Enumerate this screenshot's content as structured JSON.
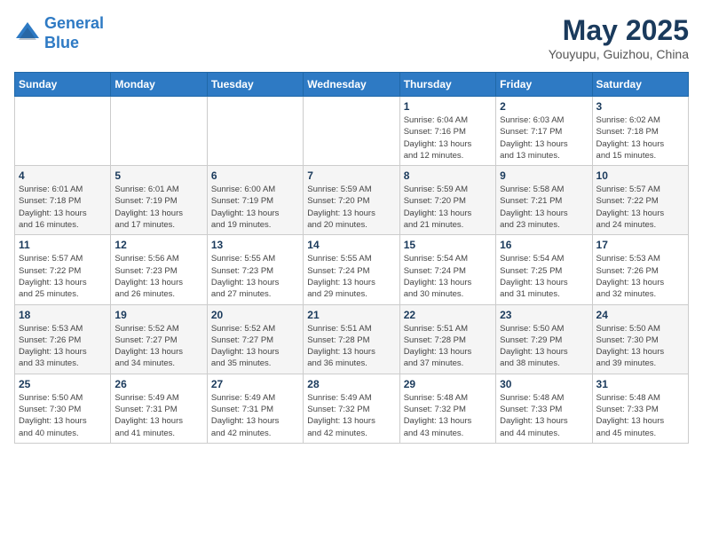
{
  "header": {
    "logo_line1": "General",
    "logo_line2": "Blue",
    "month_year": "May 2025",
    "location": "Youyupu, Guizhou, China"
  },
  "weekdays": [
    "Sunday",
    "Monday",
    "Tuesday",
    "Wednesday",
    "Thursday",
    "Friday",
    "Saturday"
  ],
  "weeks": [
    [
      {
        "day": "",
        "info": ""
      },
      {
        "day": "",
        "info": ""
      },
      {
        "day": "",
        "info": ""
      },
      {
        "day": "",
        "info": ""
      },
      {
        "day": "1",
        "info": "Sunrise: 6:04 AM\nSunset: 7:16 PM\nDaylight: 13 hours\nand 12 minutes."
      },
      {
        "day": "2",
        "info": "Sunrise: 6:03 AM\nSunset: 7:17 PM\nDaylight: 13 hours\nand 13 minutes."
      },
      {
        "day": "3",
        "info": "Sunrise: 6:02 AM\nSunset: 7:18 PM\nDaylight: 13 hours\nand 15 minutes."
      }
    ],
    [
      {
        "day": "4",
        "info": "Sunrise: 6:01 AM\nSunset: 7:18 PM\nDaylight: 13 hours\nand 16 minutes."
      },
      {
        "day": "5",
        "info": "Sunrise: 6:01 AM\nSunset: 7:19 PM\nDaylight: 13 hours\nand 17 minutes."
      },
      {
        "day": "6",
        "info": "Sunrise: 6:00 AM\nSunset: 7:19 PM\nDaylight: 13 hours\nand 19 minutes."
      },
      {
        "day": "7",
        "info": "Sunrise: 5:59 AM\nSunset: 7:20 PM\nDaylight: 13 hours\nand 20 minutes."
      },
      {
        "day": "8",
        "info": "Sunrise: 5:59 AM\nSunset: 7:20 PM\nDaylight: 13 hours\nand 21 minutes."
      },
      {
        "day": "9",
        "info": "Sunrise: 5:58 AM\nSunset: 7:21 PM\nDaylight: 13 hours\nand 23 minutes."
      },
      {
        "day": "10",
        "info": "Sunrise: 5:57 AM\nSunset: 7:22 PM\nDaylight: 13 hours\nand 24 minutes."
      }
    ],
    [
      {
        "day": "11",
        "info": "Sunrise: 5:57 AM\nSunset: 7:22 PM\nDaylight: 13 hours\nand 25 minutes."
      },
      {
        "day": "12",
        "info": "Sunrise: 5:56 AM\nSunset: 7:23 PM\nDaylight: 13 hours\nand 26 minutes."
      },
      {
        "day": "13",
        "info": "Sunrise: 5:55 AM\nSunset: 7:23 PM\nDaylight: 13 hours\nand 27 minutes."
      },
      {
        "day": "14",
        "info": "Sunrise: 5:55 AM\nSunset: 7:24 PM\nDaylight: 13 hours\nand 29 minutes."
      },
      {
        "day": "15",
        "info": "Sunrise: 5:54 AM\nSunset: 7:24 PM\nDaylight: 13 hours\nand 30 minutes."
      },
      {
        "day": "16",
        "info": "Sunrise: 5:54 AM\nSunset: 7:25 PM\nDaylight: 13 hours\nand 31 minutes."
      },
      {
        "day": "17",
        "info": "Sunrise: 5:53 AM\nSunset: 7:26 PM\nDaylight: 13 hours\nand 32 minutes."
      }
    ],
    [
      {
        "day": "18",
        "info": "Sunrise: 5:53 AM\nSunset: 7:26 PM\nDaylight: 13 hours\nand 33 minutes."
      },
      {
        "day": "19",
        "info": "Sunrise: 5:52 AM\nSunset: 7:27 PM\nDaylight: 13 hours\nand 34 minutes."
      },
      {
        "day": "20",
        "info": "Sunrise: 5:52 AM\nSunset: 7:27 PM\nDaylight: 13 hours\nand 35 minutes."
      },
      {
        "day": "21",
        "info": "Sunrise: 5:51 AM\nSunset: 7:28 PM\nDaylight: 13 hours\nand 36 minutes."
      },
      {
        "day": "22",
        "info": "Sunrise: 5:51 AM\nSunset: 7:28 PM\nDaylight: 13 hours\nand 37 minutes."
      },
      {
        "day": "23",
        "info": "Sunrise: 5:50 AM\nSunset: 7:29 PM\nDaylight: 13 hours\nand 38 minutes."
      },
      {
        "day": "24",
        "info": "Sunrise: 5:50 AM\nSunset: 7:30 PM\nDaylight: 13 hours\nand 39 minutes."
      }
    ],
    [
      {
        "day": "25",
        "info": "Sunrise: 5:50 AM\nSunset: 7:30 PM\nDaylight: 13 hours\nand 40 minutes."
      },
      {
        "day": "26",
        "info": "Sunrise: 5:49 AM\nSunset: 7:31 PM\nDaylight: 13 hours\nand 41 minutes."
      },
      {
        "day": "27",
        "info": "Sunrise: 5:49 AM\nSunset: 7:31 PM\nDaylight: 13 hours\nand 42 minutes."
      },
      {
        "day": "28",
        "info": "Sunrise: 5:49 AM\nSunset: 7:32 PM\nDaylight: 13 hours\nand 42 minutes."
      },
      {
        "day": "29",
        "info": "Sunrise: 5:48 AM\nSunset: 7:32 PM\nDaylight: 13 hours\nand 43 minutes."
      },
      {
        "day": "30",
        "info": "Sunrise: 5:48 AM\nSunset: 7:33 PM\nDaylight: 13 hours\nand 44 minutes."
      },
      {
        "day": "31",
        "info": "Sunrise: 5:48 AM\nSunset: 7:33 PM\nDaylight: 13 hours\nand 45 minutes."
      }
    ]
  ]
}
